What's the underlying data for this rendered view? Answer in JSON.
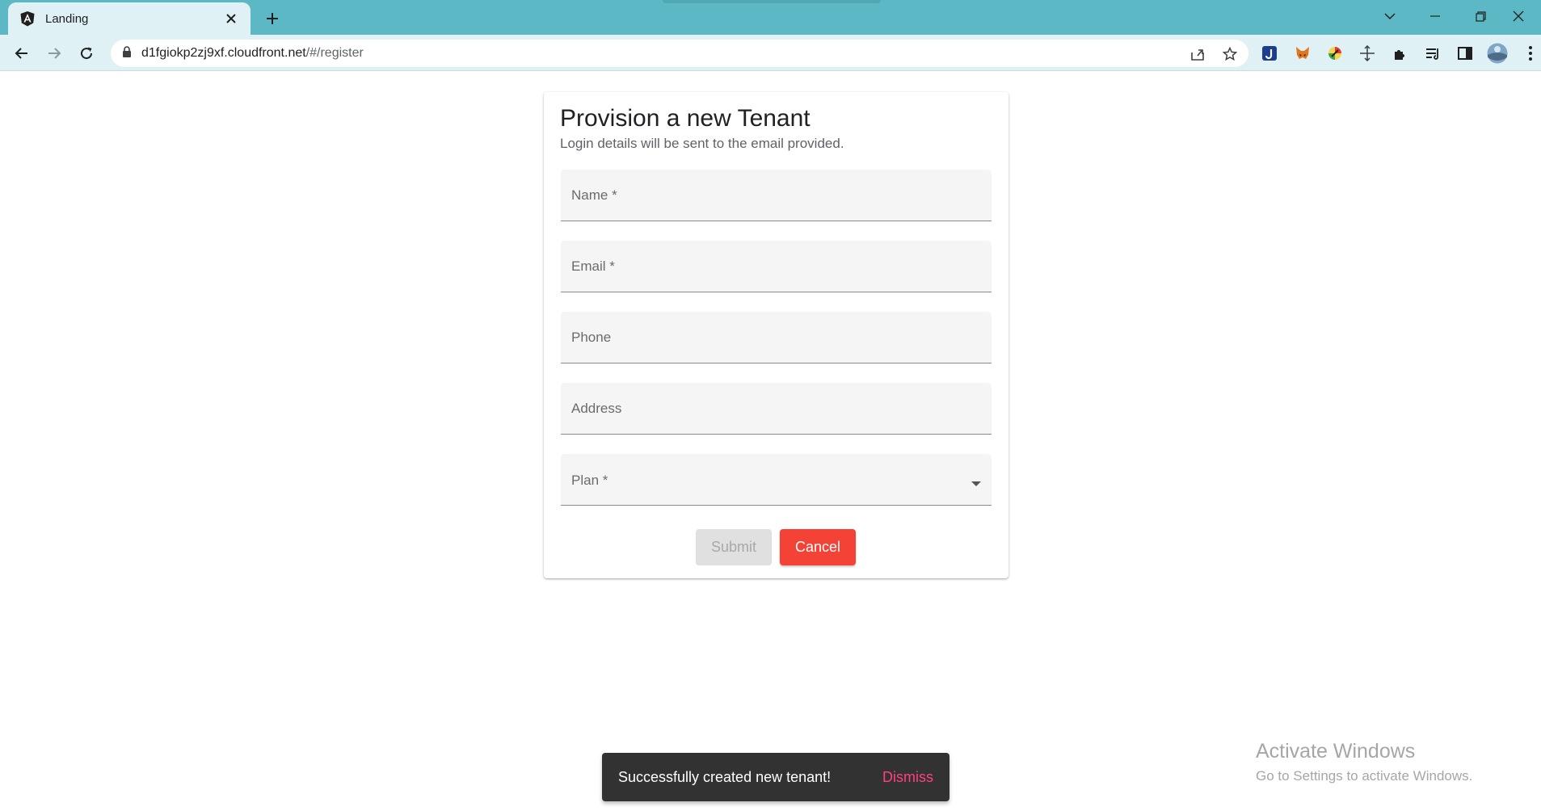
{
  "browser": {
    "tab_title": "Landing",
    "url_host": "d1fgiokp2zj9xf.cloudfront.net",
    "url_path": "/#/register",
    "colors": {
      "titlebar": "#5bb8c4",
      "toolbar": "#dff1f4"
    },
    "icons": [
      "angular-favicon-icon",
      "close-icon",
      "plus-icon",
      "chevron-down-icon",
      "minimize-icon",
      "restore-icon",
      "window-close-icon",
      "back-arrow-icon",
      "forward-arrow-icon",
      "reload-icon",
      "lock-icon",
      "share-icon",
      "star-icon",
      "extensions-icon",
      "reading-list-icon",
      "side-panel-icon",
      "profile-avatar-icon",
      "kebab-menu-icon"
    ]
  },
  "form": {
    "title": "Provision a new Tenant",
    "subtitle": "Login details will be sent to the email provided.",
    "fields": {
      "name": "Name *",
      "email": "Email *",
      "phone": "Phone",
      "address": "Address",
      "plan": "Plan *"
    },
    "submit_label": "Submit",
    "cancel_label": "Cancel",
    "colors": {
      "cancel": "#f44336",
      "submit_disabled": "#e0e0e0"
    }
  },
  "snackbar": {
    "message": "Successfully created new tenant!",
    "action": "Dismiss",
    "action_color": "#ff4081"
  },
  "watermark": {
    "line1": "Activate Windows",
    "line2": "Go to Settings to activate Windows."
  }
}
